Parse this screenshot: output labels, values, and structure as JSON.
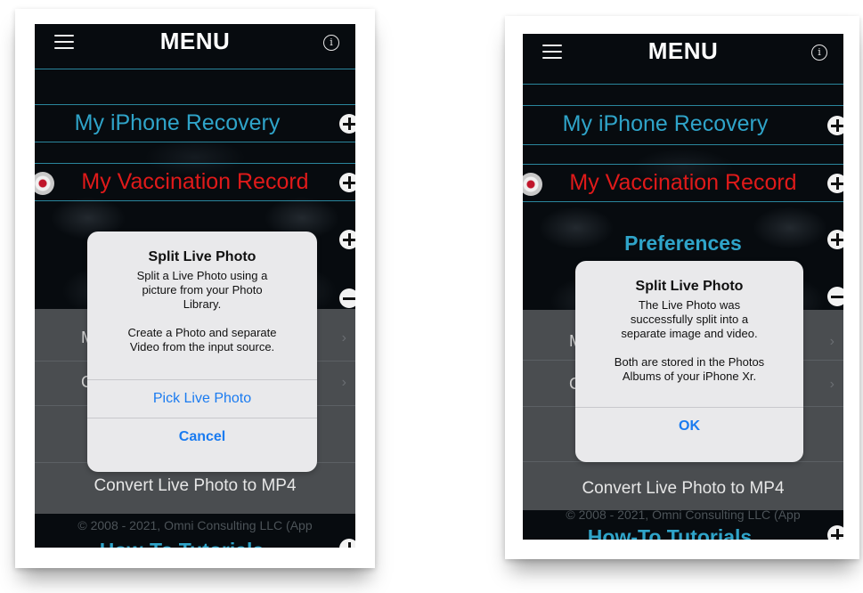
{
  "left": {
    "header": {
      "title": "MENU"
    },
    "rows": {
      "recovery": "My iPhone Recovery",
      "vaccination": "My Vaccination Record"
    },
    "sub_items": {
      "partial_letter_1": "M",
      "partial_letter_2": "C",
      "convert": "Convert Live Photo to MP4"
    },
    "copyright": "© 2008 - 2021, Omni Consulting LLC (App",
    "howto": "How-To Tutorials",
    "dialog": {
      "title": "Split Live Photo",
      "message": "Split a Live Photo using a\npicture from your Photo\nLibrary.\n\nCreate a Photo and separate\nVideo from the input source.",
      "buttons": [
        "Pick Live Photo",
        "Cancel"
      ]
    }
  },
  "right": {
    "header": {
      "title": "MENU"
    },
    "rows": {
      "recovery": "My iPhone Recovery",
      "vaccination": "My Vaccination Record",
      "preferences": "Preferences"
    },
    "sub_items": {
      "partial_letter_1": "M",
      "partial_letter_2": "C",
      "convert": "Convert Live Photo to MP4"
    },
    "copyright": "© 2008 - 2021, Omni Consulting LLC (App",
    "howto": "How-To Tutorials",
    "dialog": {
      "title": "Split Live Photo",
      "message": "The Live Photo was\nsuccessfully split into a\nseparate image and video.\n\nBoth are stored in the Photos\nAlbums of your iPhone Xr.",
      "buttons": [
        "OK"
      ]
    }
  },
  "colors": {
    "accent_blue": "#2fa4c9",
    "accent_red": "#e01a1a",
    "link_blue": "#1a7bf0",
    "divider": "#2f93ad"
  }
}
